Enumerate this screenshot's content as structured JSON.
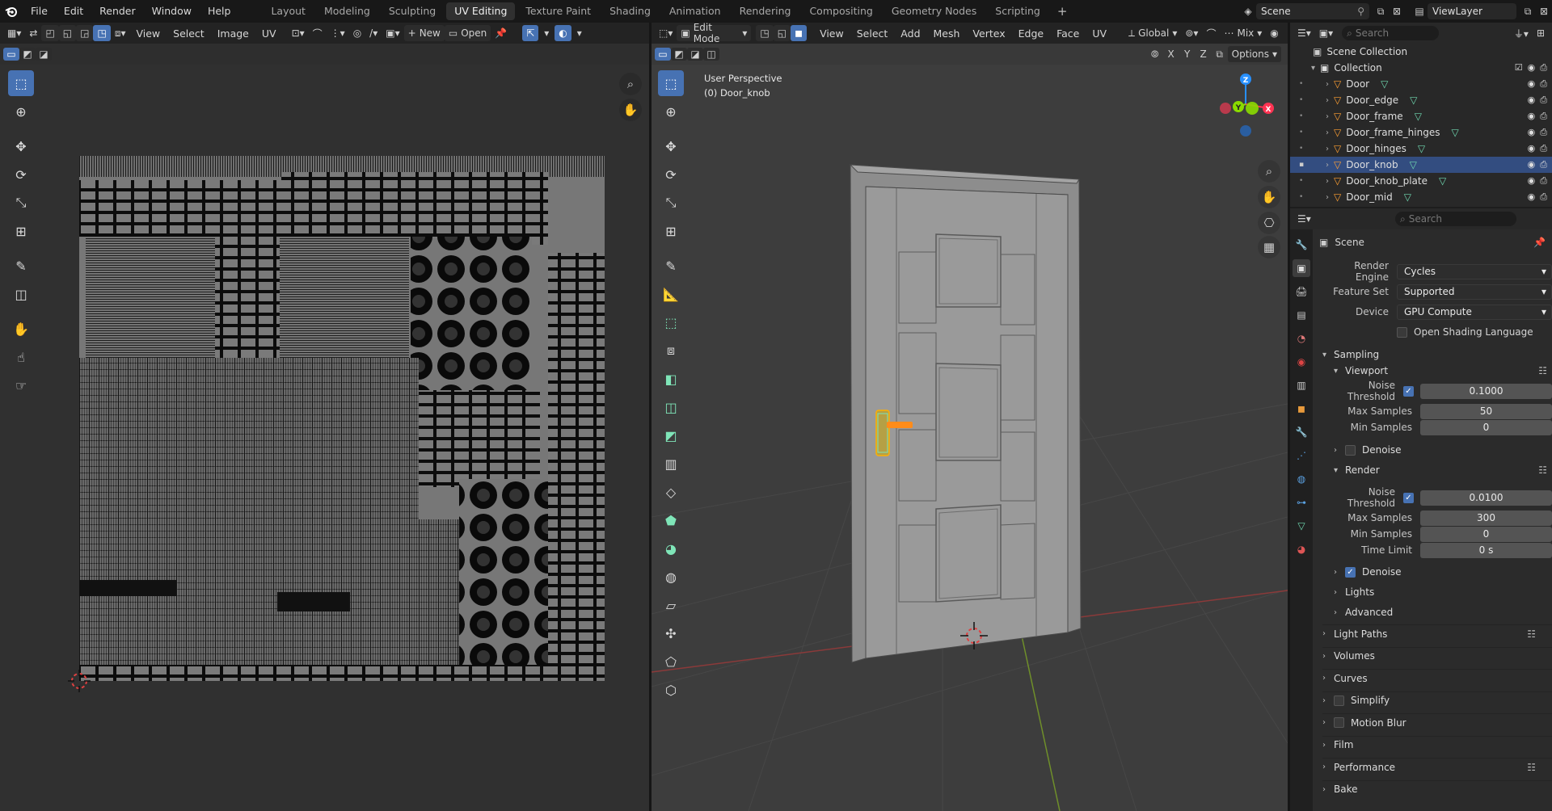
{
  "topbar": {
    "menus": [
      "File",
      "Edit",
      "Render",
      "Window",
      "Help"
    ],
    "workspaces": [
      "Layout",
      "Modeling",
      "Sculpting",
      "UV Editing",
      "Texture Paint",
      "Shading",
      "Animation",
      "Rendering",
      "Compositing",
      "Geometry Nodes",
      "Scripting"
    ],
    "active_workspace": "UV Editing",
    "scene_name": "Scene",
    "view_layer": "ViewLayer"
  },
  "uv_header": {
    "menus": [
      "View",
      "Select",
      "Image",
      "UV"
    ],
    "new_label": "New",
    "open_label": "Open"
  },
  "v3d_header": {
    "mode": "Edit Mode",
    "menus": [
      "View",
      "Select",
      "Add",
      "Mesh",
      "Vertex",
      "Edge",
      "Face",
      "UV"
    ],
    "orientation": "Global",
    "shading": "Mix",
    "options_label": "Options",
    "axes": [
      "X",
      "Y",
      "Z"
    ]
  },
  "viewport": {
    "perspective": "User Perspective",
    "object_label": "(0) Door_knob"
  },
  "outliner": {
    "search_placeholder": "Search",
    "root": "Scene Collection",
    "collection": "Collection",
    "items": [
      "Door",
      "Door_edge",
      "Door_frame",
      "Door_frame_hinges",
      "Door_hinges",
      "Door_knob",
      "Door_knob_plate",
      "Door_mid"
    ],
    "selected": "Door_knob"
  },
  "properties": {
    "search_placeholder": "Search",
    "context": "Scene",
    "render_engine_label": "Render Engine",
    "render_engine": "Cycles",
    "feature_set_label": "Feature Set",
    "feature_set": "Supported",
    "device_label": "Device",
    "device": "GPU Compute",
    "osl_label": "Open Shading Language",
    "sampling": "Sampling",
    "viewport": "Viewport",
    "noise_threshold_label": "Noise Threshold",
    "viewport_noise": "0.1000",
    "max_samples_label": "Max Samples",
    "viewport_max": "50",
    "min_samples_label": "Min Samples",
    "viewport_min": "0",
    "denoise_label": "Denoise",
    "render": "Render",
    "render_noise": "0.0100",
    "render_max": "300",
    "render_min": "0",
    "time_limit_label": "Time Limit",
    "time_limit": "0 s",
    "lights": "Lights",
    "advanced": "Advanced",
    "panels": [
      "Light Paths",
      "Volumes",
      "Curves",
      "Simplify",
      "Motion Blur",
      "Film",
      "Performance",
      "Bake"
    ]
  },
  "colors": {
    "accent": "#4772b3",
    "selected_row": "#334d80",
    "active_object": "#ffa033",
    "mesh_icon": "#6fd8b0",
    "axis_x": "#ff3352",
    "axis_y": "#8bdc00",
    "axis_z": "#2890ff"
  }
}
